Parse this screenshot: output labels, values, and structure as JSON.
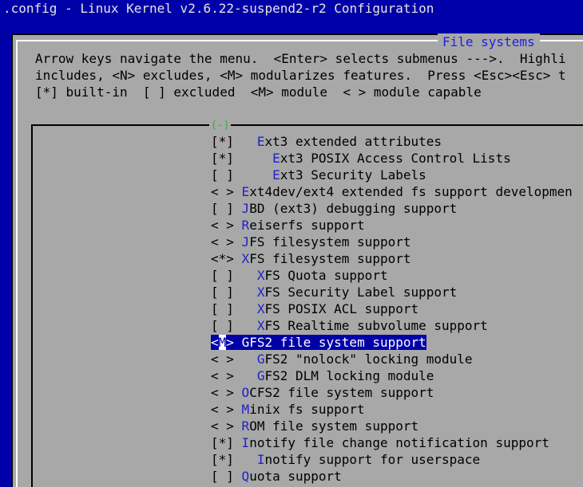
{
  "window": {
    "title": ".config - Linux Kernel v2.6.22-suspend2-r2 Configuration"
  },
  "dialog": {
    "title": "File systems",
    "help": [
      "Arrow keys navigate the menu.  <Enter> selects submenus --->.  Highli",
      "includes, <N> excludes, <M> modularizes features.  Press <Esc><Esc> t",
      "[*] built-in  [ ] excluded  <M> module  < > module capable"
    ],
    "menu_top_label": "(-)",
    "items": [
      {
        "state": "[*]",
        "indent": "   ",
        "hot": "E",
        "rest": "xt3 extended attributes",
        "selected": false
      },
      {
        "state": "[*]",
        "indent": "     ",
        "hot": "E",
        "rest": "xt3 POSIX Access Control Lists",
        "selected": false
      },
      {
        "state": "[ ]",
        "indent": "     ",
        "hot": "E",
        "rest": "xt3 Security Labels",
        "selected": false
      },
      {
        "state": "< >",
        "indent": " ",
        "hot": "E",
        "rest": "xt4dev/ext4 extended fs support developmen",
        "selected": false
      },
      {
        "state": "[ ]",
        "indent": " ",
        "hot": "J",
        "rest": "BD (ext3) debugging support",
        "selected": false
      },
      {
        "state": "< >",
        "indent": " ",
        "hot": "R",
        "rest": "eiserfs support",
        "selected": false
      },
      {
        "state": "< >",
        "indent": " ",
        "hot": "J",
        "rest": "FS filesystem support",
        "selected": false
      },
      {
        "state": "<*>",
        "indent": " ",
        "hot": "X",
        "rest": "FS filesystem support",
        "selected": false
      },
      {
        "state": "[ ]",
        "indent": "   ",
        "hot": "X",
        "rest": "FS Quota support",
        "selected": false
      },
      {
        "state": "[ ]",
        "indent": "   ",
        "hot": "X",
        "rest": "FS Security Label support",
        "selected": false
      },
      {
        "state": "[ ]",
        "indent": "   ",
        "hot": "X",
        "rest": "FS POSIX ACL support",
        "selected": false
      },
      {
        "state": "[ ]",
        "indent": "   ",
        "hot": "X",
        "rest": "FS Realtime subvolume support",
        "selected": false
      },
      {
        "state": "<M>",
        "indent": " ",
        "hot": "G",
        "rest": "FS2 file system support",
        "selected": true
      },
      {
        "state": "< >",
        "indent": "   ",
        "hot": "G",
        "rest": "FS2 \"nolock\" locking module",
        "selected": false
      },
      {
        "state": "< >",
        "indent": "   ",
        "hot": "G",
        "rest": "FS2 DLM locking module",
        "selected": false
      },
      {
        "state": "< >",
        "indent": " ",
        "hot": "O",
        "rest": "CFS2 file system support",
        "selected": false
      },
      {
        "state": "< >",
        "indent": " ",
        "hot": "M",
        "rest": "inix fs support",
        "selected": false
      },
      {
        "state": "< >",
        "indent": " ",
        "hot": "R",
        "rest": "OM file system support",
        "selected": false
      },
      {
        "state": "[*]",
        "indent": " ",
        "hot": "I",
        "rest": "notify file change notification support",
        "selected": false
      },
      {
        "state": "[*]",
        "indent": "   ",
        "hot": "I",
        "rest": "notify support for userspace",
        "selected": false
      },
      {
        "state": "[ ]",
        "indent": " ",
        "hot": "Q",
        "rest": "uota support",
        "selected": false
      }
    ]
  },
  "colors": {
    "background": "#0000a8",
    "dialog": "#a8a8a8",
    "hotkey": "#2020d0",
    "selection": "#0000a8"
  }
}
